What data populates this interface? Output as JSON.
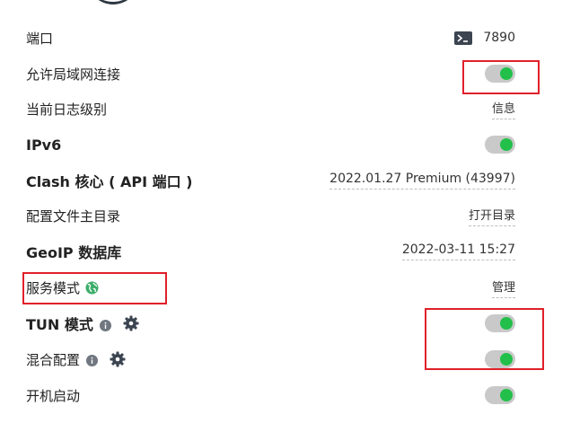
{
  "settings": {
    "port": {
      "label": "端口",
      "value": "7890",
      "icon": "terminal-icon"
    },
    "allow_lan": {
      "label": "允许局域网连接",
      "enabled": true
    },
    "log_level": {
      "label": "当前日志级别",
      "value": "信息"
    },
    "ipv6": {
      "label": "IPv6",
      "enabled": true
    },
    "clash_core": {
      "label": "Clash 核心 ( API 端口 )",
      "value": "2022.01.27 Premium (43997)"
    },
    "config_dir": {
      "label": "配置文件主目录",
      "value": "打开目录"
    },
    "geoip": {
      "label": "GeoIP 数据库",
      "value": "2022-03-11 15:27"
    },
    "service_mode": {
      "label": "服务模式",
      "value": "管理",
      "icon": "globe-icon"
    },
    "tun_mode": {
      "label": "TUN 模式",
      "enabled": true,
      "icons": [
        "info-icon",
        "gear-icon"
      ]
    },
    "mixin": {
      "label": "混合配置",
      "enabled": true,
      "icons": [
        "info-icon",
        "gear-icon"
      ]
    },
    "autostart": {
      "label": "开机启动",
      "enabled": true
    }
  },
  "colors": {
    "toggle_track": "#c9c9c9",
    "toggle_knob": "#22c04a",
    "highlight_box": "#e1202a",
    "globe": "#3dae6a"
  }
}
